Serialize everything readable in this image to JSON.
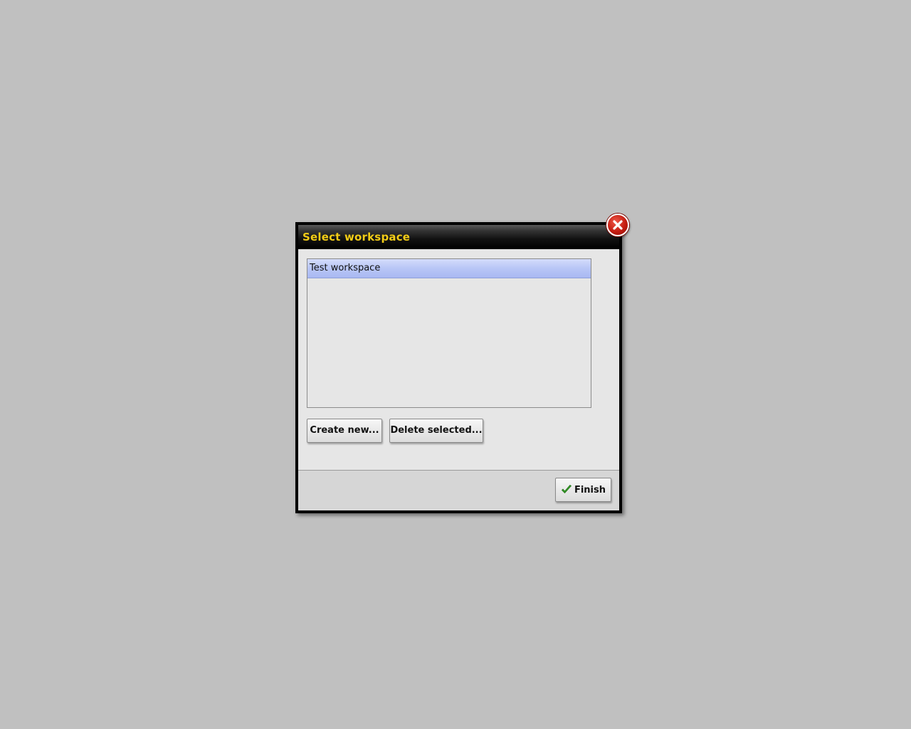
{
  "dialog": {
    "title": "Select workspace",
    "close_icon": "close-icon",
    "workspaces": [
      {
        "label": "Test workspace",
        "selected": true
      }
    ],
    "buttons": {
      "create_label": "Create new...",
      "delete_label": "Delete selected...",
      "finish_label": "Finish",
      "finish_icon": "check-icon"
    }
  },
  "colors": {
    "desktop_bg": "#c0c0c0",
    "title_text": "#f2cc16",
    "selection": "#b8c6f6",
    "close_red": "#c41d12",
    "check_green": "#3aa52a"
  }
}
